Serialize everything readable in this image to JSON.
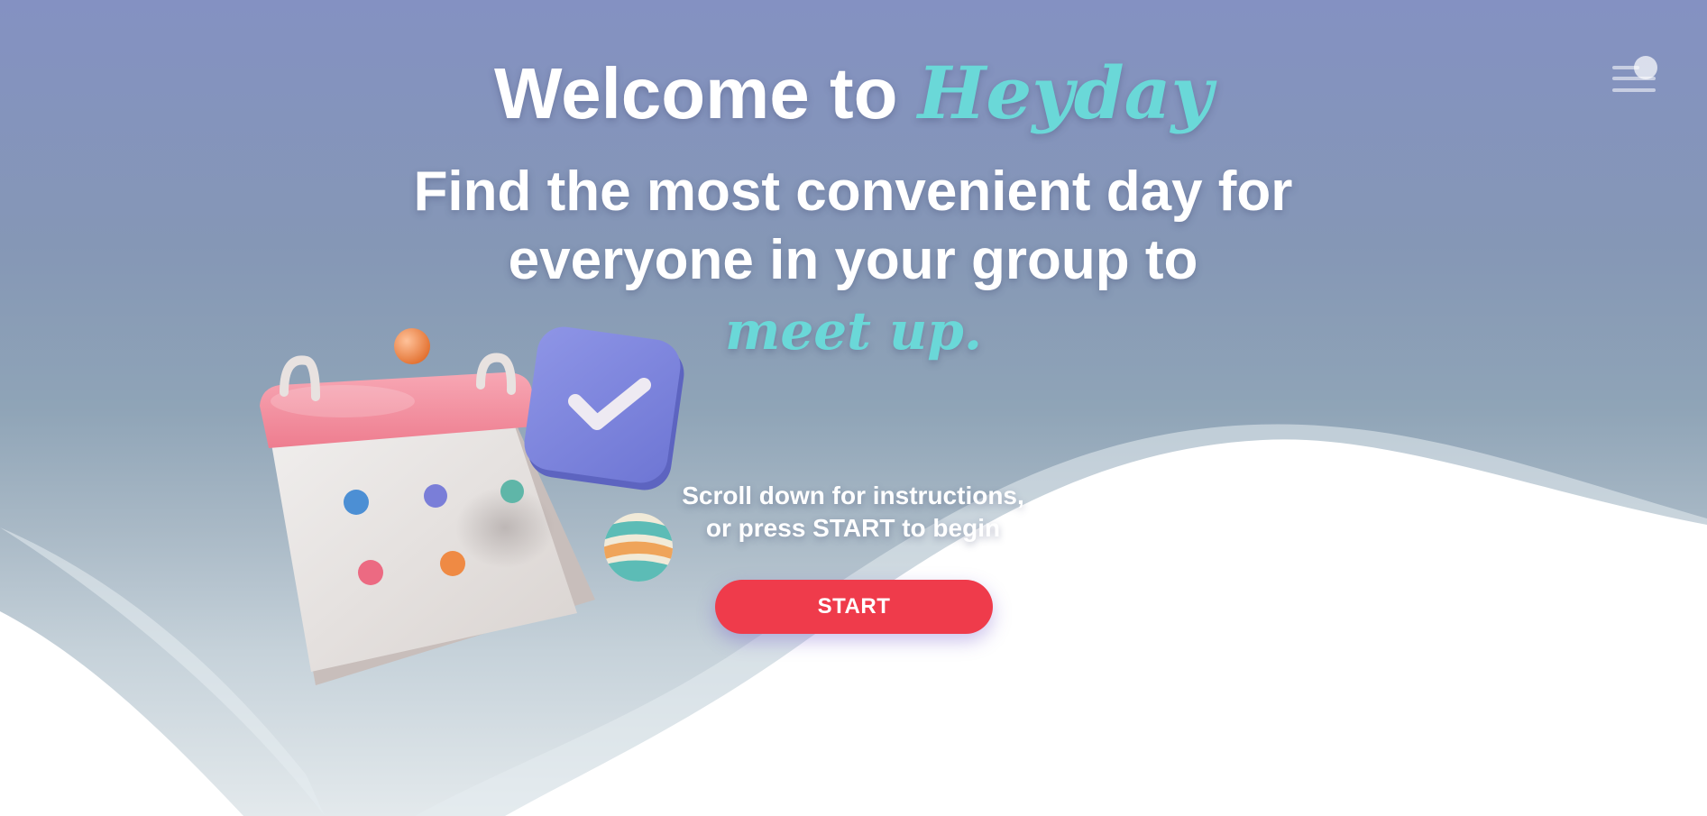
{
  "header": {
    "title_prefix": "Welcome to ",
    "brand": "Heyday"
  },
  "hero": {
    "subtitle": "Find the most convenient day for everyone in your group to",
    "highlight": "meet up.",
    "instructions_line1": "Scroll down for instructions,",
    "instructions_line2": "or press START to begin",
    "start_label": "START"
  },
  "menu": {
    "icon": "hamburger-menu-icon"
  },
  "illustration": {
    "icons": [
      "calendar-icon",
      "checkmark-icon",
      "orange-ball-icon",
      "striped-ball-icon"
    ]
  },
  "colors": {
    "accent": "#6ad8d8",
    "button": "#ef3b4b",
    "checkmark_tile": "#7f86dc",
    "calendar_top": "#f28a9a"
  }
}
